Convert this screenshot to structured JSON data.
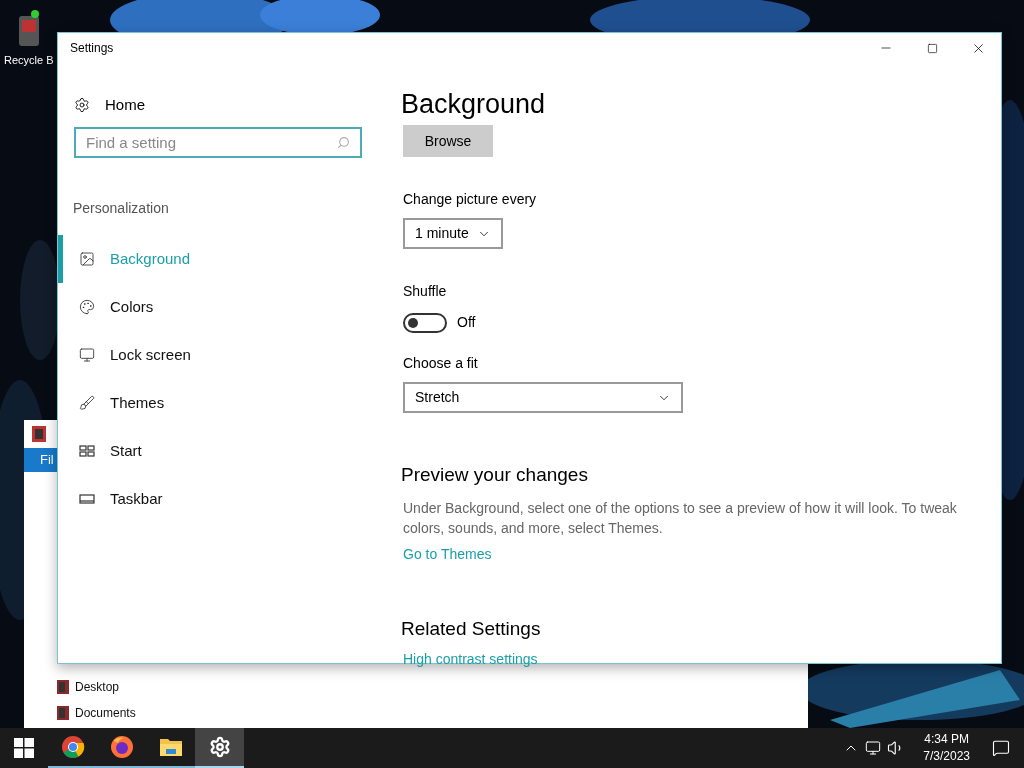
{
  "desktop": {
    "icons": [
      {
        "label": "Recycle B"
      }
    ]
  },
  "explorer_window": {
    "menu_tab": "Fil",
    "nav_items": [
      "Desktop",
      "Documents"
    ]
  },
  "settings_window": {
    "title": "Settings",
    "sidebar": {
      "home": "Home",
      "search": {
        "placeholder": "Find a setting"
      },
      "section": "Personalization",
      "items": [
        {
          "label": "Background",
          "selected": true
        },
        {
          "label": "Colors",
          "selected": false
        },
        {
          "label": "Lock screen",
          "selected": false
        },
        {
          "label": "Themes",
          "selected": false
        },
        {
          "label": "Start",
          "selected": false
        },
        {
          "label": "Taskbar",
          "selected": false
        }
      ]
    },
    "content": {
      "heading": "Background",
      "browse_button": "Browse",
      "change_picture": {
        "label": "Change picture every",
        "value": "1 minute"
      },
      "shuffle": {
        "label": "Shuffle",
        "on": false,
        "reading": "Off"
      },
      "fit": {
        "label": "Choose a fit",
        "value": "Stretch"
      },
      "preview": {
        "heading": "Preview your changes",
        "text": "Under Background, select one of the options to see a preview of how it will look. To tweak colors, sounds, and more, select Themes.",
        "link": "Go to Themes"
      },
      "related": {
        "heading": "Related Settings",
        "link": "High contrast settings"
      }
    }
  },
  "taskbar": {
    "apps": [
      {
        "kind": "chrome",
        "selected": false
      },
      {
        "kind": "firefox",
        "selected": false
      },
      {
        "kind": "explorer",
        "selected": false
      },
      {
        "kind": "settings",
        "selected": true
      }
    ],
    "time": "4:34 PM",
    "date": "7/3/2023"
  }
}
